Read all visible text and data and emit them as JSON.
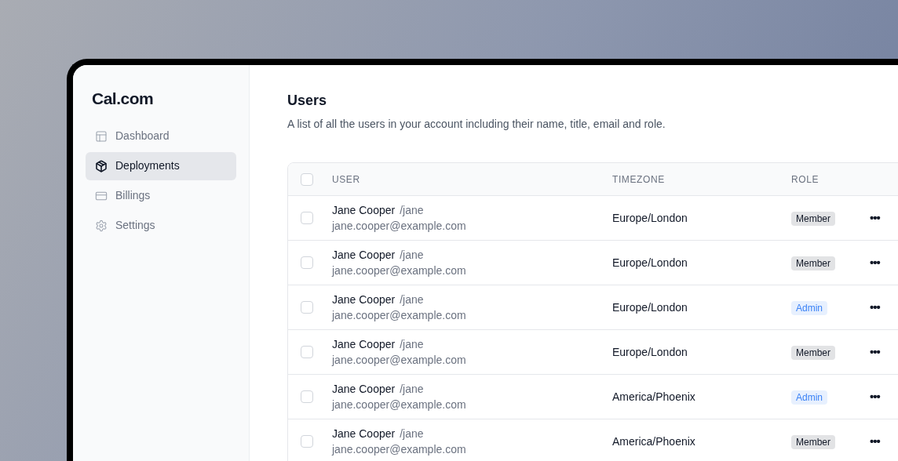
{
  "sidebar": {
    "logo": "Cal.com",
    "items": [
      {
        "label": "Dashboard",
        "selected": false
      },
      {
        "label": "Deployments",
        "selected": true
      },
      {
        "label": "Billings",
        "selected": false
      },
      {
        "label": "Settings",
        "selected": false
      }
    ]
  },
  "page": {
    "title": "Users",
    "subtitle": "A list of all the users in your account including their name, title, email and role."
  },
  "table": {
    "select_all": {
      "checked": false
    },
    "columns": [
      "USER",
      "TIMEZONE",
      "ROLE"
    ],
    "rows": [
      {
        "checked": false,
        "name": "Jane Cooper",
        "handle": "/jane",
        "email": "jane.cooper@example.com",
        "timezone": "Europe/London",
        "role": "Member",
        "color": "#111827",
        "menu": "•••"
      },
      {
        "checked": false,
        "name": "Jane Cooper",
        "handle": "/jane",
        "email": "jane.cooper@example.com",
        "timezone": "Europe/London",
        "role": "Member",
        "color": "#111827",
        "menu": "•••"
      },
      {
        "checked": false,
        "name": "Jane Cooper",
        "handle": "/jane",
        "email": "jane.cooper@example.com",
        "timezone": "Europe/London",
        "role": "Admin",
        "color": "#3b82f6",
        "menu": "•••"
      },
      {
        "checked": false,
        "name": "Jane Cooper",
        "handle": "/jane",
        "email": "jane.cooper@example.com",
        "timezone": "Europe/London",
        "role": "Member",
        "color": "#111827",
        "menu": "•••"
      },
      {
        "checked": false,
        "name": "Jane Cooper",
        "handle": "/jane",
        "email": "jane.cooper@example.com",
        "timezone": "America/Phoenix",
        "role": "Admin",
        "color": "#3b82f6",
        "menu": "•••"
      },
      {
        "checked": false,
        "name": "Jane Cooper",
        "handle": "/jane",
        "email": "jane.cooper@example.com",
        "timezone": "America/Phoenix",
        "role": "Member",
        "color": "#111827",
        "menu": "•••"
      }
    ]
  }
}
